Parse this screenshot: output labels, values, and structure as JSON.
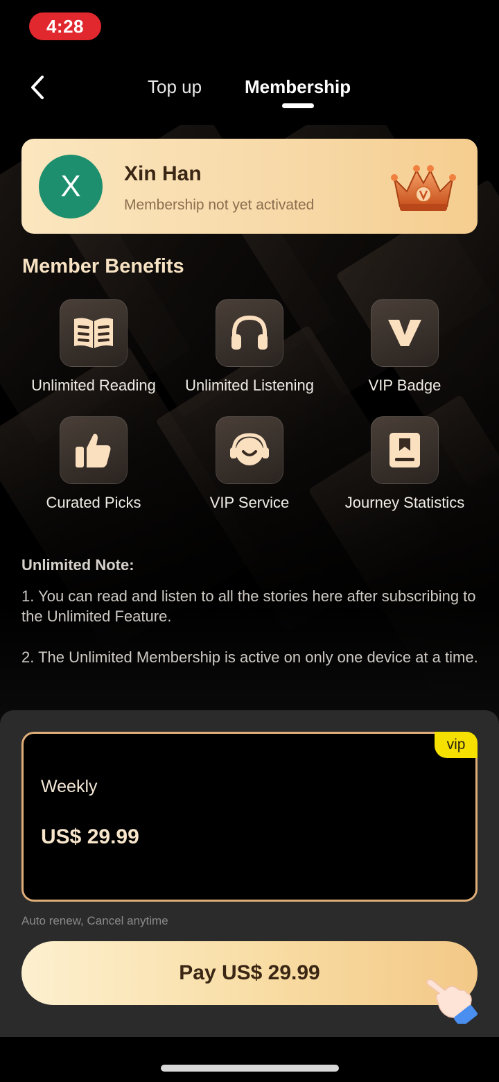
{
  "status_bar": {
    "time": "4:28"
  },
  "nav": {
    "tabs": [
      {
        "label": "Top up",
        "active": false
      },
      {
        "label": "Membership",
        "active": true
      }
    ]
  },
  "user": {
    "avatar_letter": "X",
    "name": "Xin Han",
    "status": "Membership not yet activated",
    "avatar_color": "#1d8f6e"
  },
  "benefits": {
    "title": "Member Benefits",
    "items": [
      {
        "label": "Unlimited Reading",
        "icon": "open-book-icon"
      },
      {
        "label": "Unlimited Listening",
        "icon": "headphones-icon"
      },
      {
        "label": "VIP Badge",
        "icon": "vip-v-icon"
      },
      {
        "label": "Curated Picks",
        "icon": "thumbs-up-icon"
      },
      {
        "label": "VIP Service",
        "icon": "customer-service-icon"
      },
      {
        "label": "Journey Statistics",
        "icon": "statistics-book-icon"
      }
    ]
  },
  "note": {
    "title": "Unlimited Note:",
    "lines": [
      "1. You can read and listen to all the stories here after subscribing to the Unlimited Feature.",
      "2. The Unlimited Membership is active on only one device at a time."
    ]
  },
  "plan": {
    "badge": "vip",
    "name": "Weekly",
    "price": "US$ 29.99",
    "renew_note": "Auto renew, Cancel anytime"
  },
  "pay_button": {
    "label": "Pay US$ 29.99"
  },
  "colors": {
    "accent_gold": "#f7d9a7",
    "plan_border": "#e0ae79",
    "vip_badge": "#f5e000",
    "status_time_bg": "#e0282e"
  }
}
